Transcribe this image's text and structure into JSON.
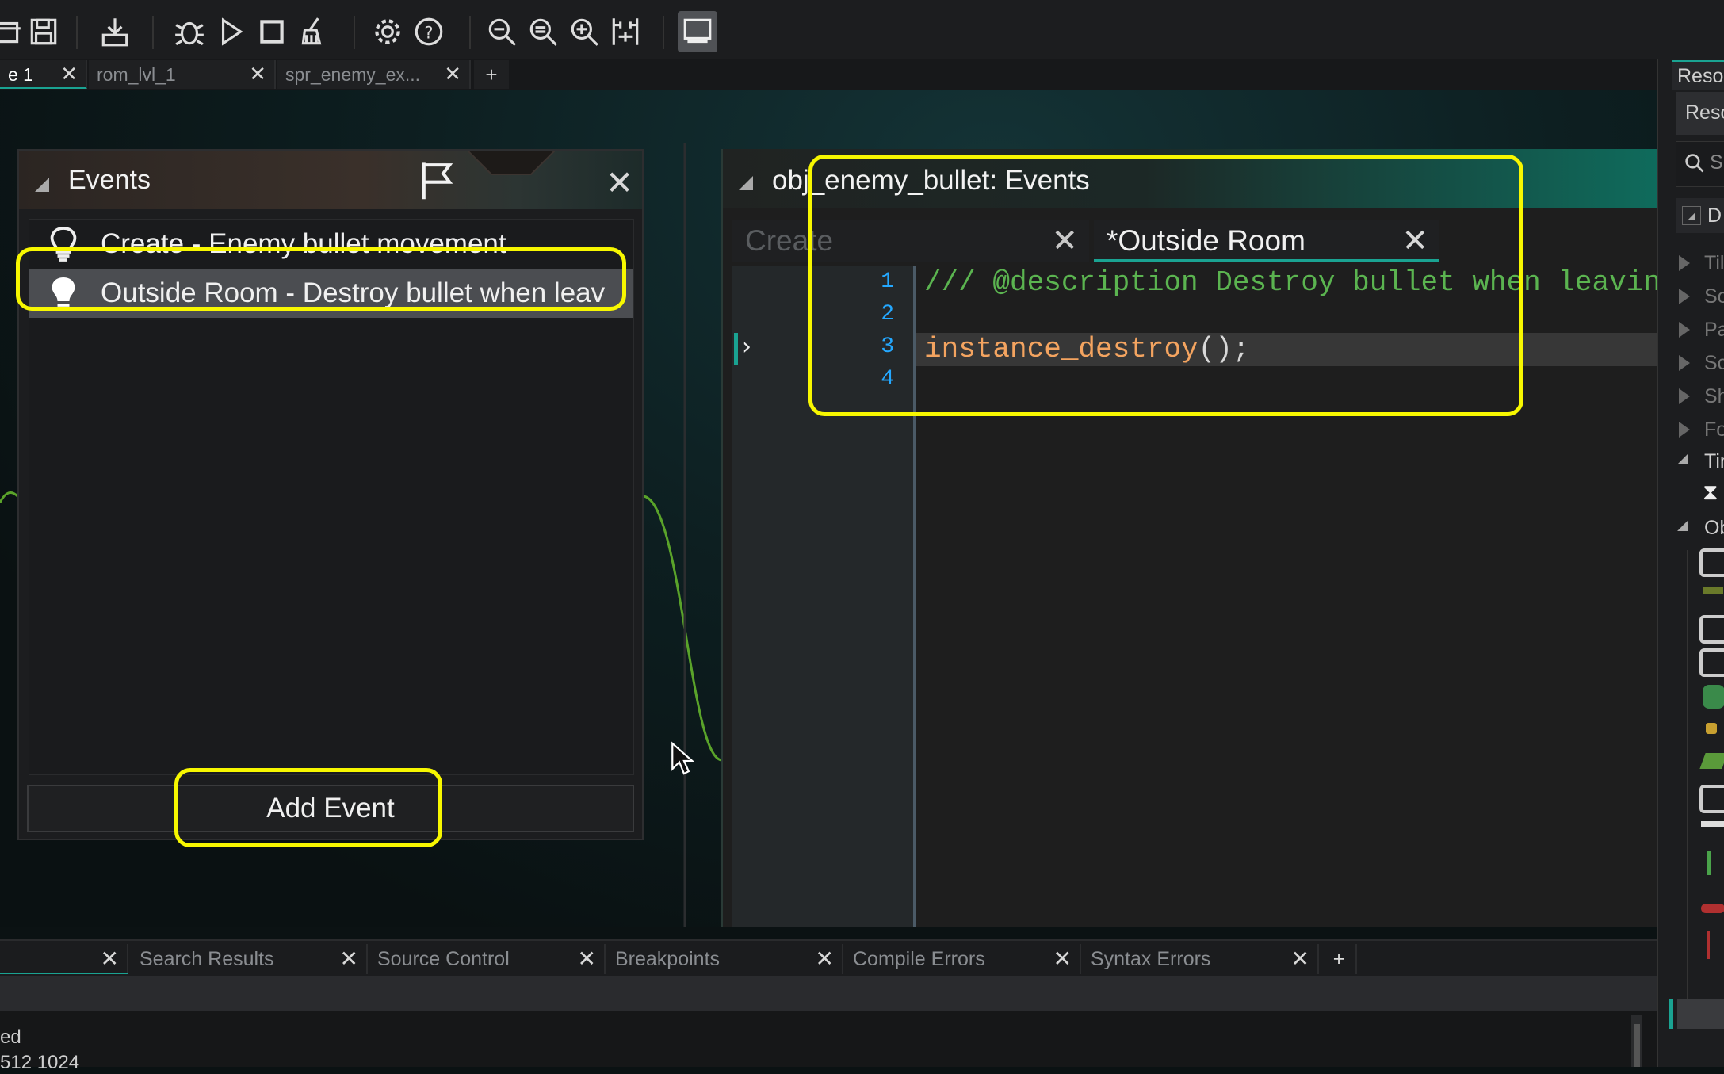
{
  "toolbar": {
    "buttons": [
      "open-icon",
      "save-icon",
      "export-icon",
      "debug-icon",
      "run-icon",
      "stop-icon",
      "clean-icon",
      "settings-icon",
      "help-icon",
      "zoom-out-icon",
      "zoom-reset-icon",
      "zoom-in-icon",
      "fit-icon",
      "workspace-icon"
    ]
  },
  "doc_tabs": [
    {
      "label": "e 1",
      "selected": true
    },
    {
      "label": "rom_lvl_1",
      "selected": false
    },
    {
      "label": "spr_enemy_ex...",
      "selected": false
    }
  ],
  "doc_tabs_add": "+",
  "events_panel": {
    "title": "Events",
    "events": [
      {
        "label": "Create - Enemy bullet movement",
        "selected": false
      },
      {
        "label": "Outside Room - Destroy bullet when leav",
        "selected": true
      }
    ],
    "add_button": "Add Event"
  },
  "editor": {
    "title": "obj_enemy_bullet: Events",
    "tabs": [
      {
        "label": "Create",
        "selected": false
      },
      {
        "label": "*Outside Room",
        "selected": true
      }
    ],
    "line_numbers": [
      "1",
      "2",
      "3",
      "4"
    ],
    "code": {
      "line1": "/// @description Destroy bullet when leaving",
      "line3_func": "instance_destroy",
      "line3_rest": "();"
    }
  },
  "resources": {
    "tab": "Resou",
    "header": "Reso",
    "search_placeholder": "S",
    "dropdown": "D",
    "groups": [
      "Tile",
      "So",
      "Pat",
      "Scr",
      "Sha",
      "Fo",
      "Tim",
      "Ob"
    ]
  },
  "bottom_tabs": [
    {
      "label": ""
    },
    {
      "label": "Search Results"
    },
    {
      "label": "Source Control"
    },
    {
      "label": "Breakpoints"
    },
    {
      "label": "Compile Errors"
    },
    {
      "label": "Syntax Errors"
    }
  ],
  "bottom_tabs_add": "+",
  "output": {
    "line1": "ed",
    "line2": "512 1024"
  },
  "colors": {
    "highlight": "#f7f700",
    "comment": "#5bb450",
    "function": "#f4a460",
    "line_number": "#24a8ff",
    "accent": "#1aa392"
  }
}
